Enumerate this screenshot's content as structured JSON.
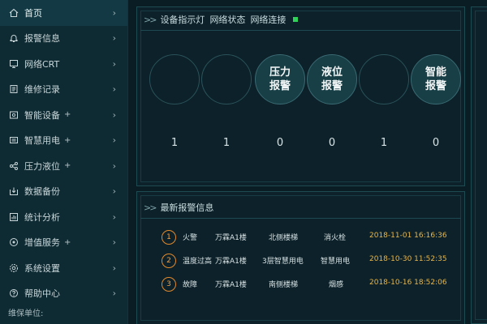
{
  "sidebar": {
    "items": [
      {
        "label": "首页",
        "icon": "home-icon",
        "plus": ""
      },
      {
        "label": "报警信息",
        "icon": "bell-icon",
        "plus": ""
      },
      {
        "label": "网络CRT",
        "icon": "monitor-icon",
        "plus": ""
      },
      {
        "label": "维修记录",
        "icon": "wrench-icon",
        "plus": ""
      },
      {
        "label": "智能设备",
        "icon": "device-icon",
        "plus": "+"
      },
      {
        "label": "智慧用电",
        "icon": "power-icon",
        "plus": "+"
      },
      {
        "label": "压力液位",
        "icon": "gauge-icon",
        "plus": "+"
      },
      {
        "label": "数据备份",
        "icon": "backup-icon",
        "plus": ""
      },
      {
        "label": "统计分析",
        "icon": "stats-icon",
        "plus": ""
      },
      {
        "label": "增值服务",
        "icon": "service-icon",
        "plus": "+"
      },
      {
        "label": "系统设置",
        "icon": "gear-icon",
        "plus": ""
      },
      {
        "label": "帮助中心",
        "icon": "help-icon",
        "plus": ""
      }
    ],
    "chevron": "›",
    "footer": "维保单位:"
  },
  "status_panel": {
    "arrows": ">>",
    "header_items": [
      "设备指示灯",
      "网络状态",
      "网络连接"
    ],
    "status_color": "#2fd35a",
    "circles": [
      {
        "label": "",
        "count": "1"
      },
      {
        "label": "",
        "count": "1"
      },
      {
        "label": "压力报警",
        "count": "0"
      },
      {
        "label": "液位报警",
        "count": "0"
      },
      {
        "label": "",
        "count": "1"
      },
      {
        "label": "智能报警",
        "count": "0"
      }
    ]
  },
  "alarm_panel": {
    "arrows": ">>",
    "title": "最新报警信息",
    "rows": [
      {
        "num": "1",
        "type": "火警",
        "building": "万霖A1楼",
        "location": "北侧楼梯",
        "device": "消火栓",
        "time": "2018-11-01 16:16:36"
      },
      {
        "num": "2",
        "type": "温度过高",
        "building": "万霖A1楼",
        "location": "3层智慧用电",
        "device": "智慧用电",
        "time": "2018-10-30 11:52:35"
      },
      {
        "num": "3",
        "type": "故障",
        "building": "万霖A1楼",
        "location": "南侧楼梯",
        "device": "烟感",
        "time": "2018-10-16 18:52:06"
      }
    ]
  }
}
